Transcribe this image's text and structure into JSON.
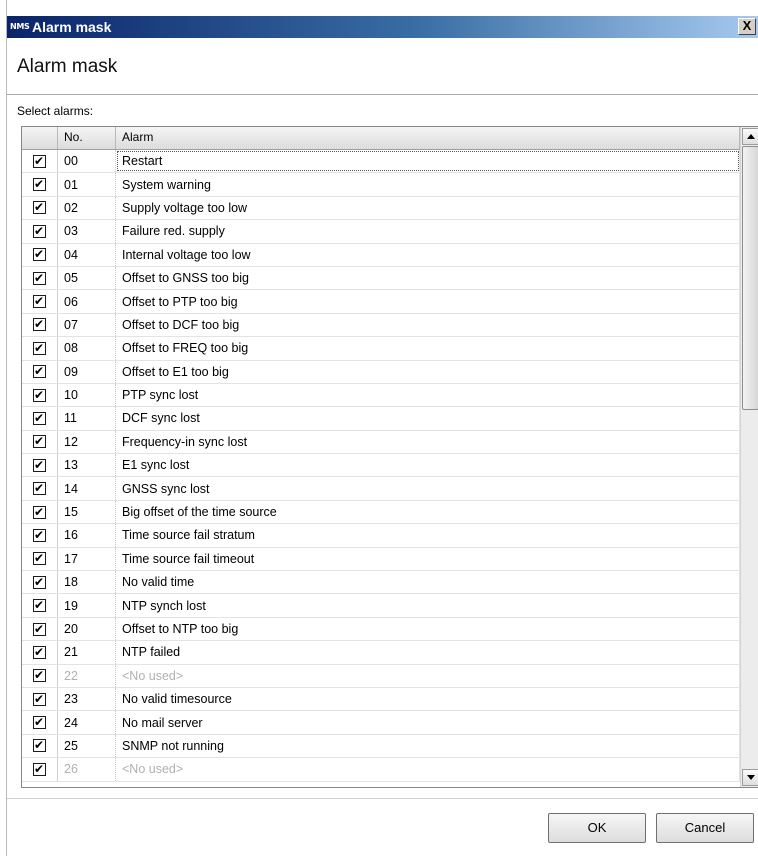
{
  "window": {
    "app_icon_text": "NMS",
    "title": "Alarm mask",
    "close_label": "X"
  },
  "header": {
    "heading": "Alarm mask"
  },
  "select_label": "Select alarms:",
  "grid": {
    "columns": [
      "",
      "No.",
      "Alarm"
    ],
    "rows": [
      {
        "checked": true,
        "no": "00",
        "alarm": "Restart",
        "used": true
      },
      {
        "checked": true,
        "no": "01",
        "alarm": "System warning",
        "used": true
      },
      {
        "checked": true,
        "no": "02",
        "alarm": "Supply voltage too low",
        "used": true
      },
      {
        "checked": true,
        "no": "03",
        "alarm": "Failure red. supply",
        "used": true
      },
      {
        "checked": true,
        "no": "04",
        "alarm": "Internal voltage too low",
        "used": true
      },
      {
        "checked": true,
        "no": "05",
        "alarm": "Offset to GNSS too big",
        "used": true
      },
      {
        "checked": true,
        "no": "06",
        "alarm": "Offset to PTP too big",
        "used": true
      },
      {
        "checked": true,
        "no": "07",
        "alarm": "Offset to DCF too big",
        "used": true
      },
      {
        "checked": true,
        "no": "08",
        "alarm": "Offset to FREQ too big",
        "used": true
      },
      {
        "checked": true,
        "no": "09",
        "alarm": "Offset to E1 too big",
        "used": true
      },
      {
        "checked": true,
        "no": "10",
        "alarm": "PTP sync lost",
        "used": true
      },
      {
        "checked": true,
        "no": "11",
        "alarm": "DCF sync lost",
        "used": true
      },
      {
        "checked": true,
        "no": "12",
        "alarm": "Frequency-in sync lost",
        "used": true
      },
      {
        "checked": true,
        "no": "13",
        "alarm": "E1 sync lost",
        "used": true
      },
      {
        "checked": true,
        "no": "14",
        "alarm": "GNSS sync lost",
        "used": true
      },
      {
        "checked": true,
        "no": "15",
        "alarm": "Big offset of the time source",
        "used": true
      },
      {
        "checked": true,
        "no": "16",
        "alarm": "Time source fail stratum",
        "used": true
      },
      {
        "checked": true,
        "no": "17",
        "alarm": "Time source fail timeout",
        "used": true
      },
      {
        "checked": true,
        "no": "18",
        "alarm": "No valid time",
        "used": true
      },
      {
        "checked": true,
        "no": "19",
        "alarm": "NTP synch lost",
        "used": true
      },
      {
        "checked": true,
        "no": "20",
        "alarm": "Offset to NTP too big",
        "used": true
      },
      {
        "checked": true,
        "no": "21",
        "alarm": "NTP failed",
        "used": true
      },
      {
        "checked": true,
        "no": "22",
        "alarm": "<No used>",
        "used": false
      },
      {
        "checked": true,
        "no": "23",
        "alarm": "No valid timesource",
        "used": true
      },
      {
        "checked": true,
        "no": "24",
        "alarm": "No mail server",
        "used": true
      },
      {
        "checked": true,
        "no": "25",
        "alarm": "SNMP not running",
        "used": true
      },
      {
        "checked": true,
        "no": "26",
        "alarm": "<No used>",
        "used": false
      }
    ],
    "check_mark_glyph": "✔"
  },
  "buttons": {
    "ok_label": "OK",
    "cancel_label": "Cancel"
  }
}
